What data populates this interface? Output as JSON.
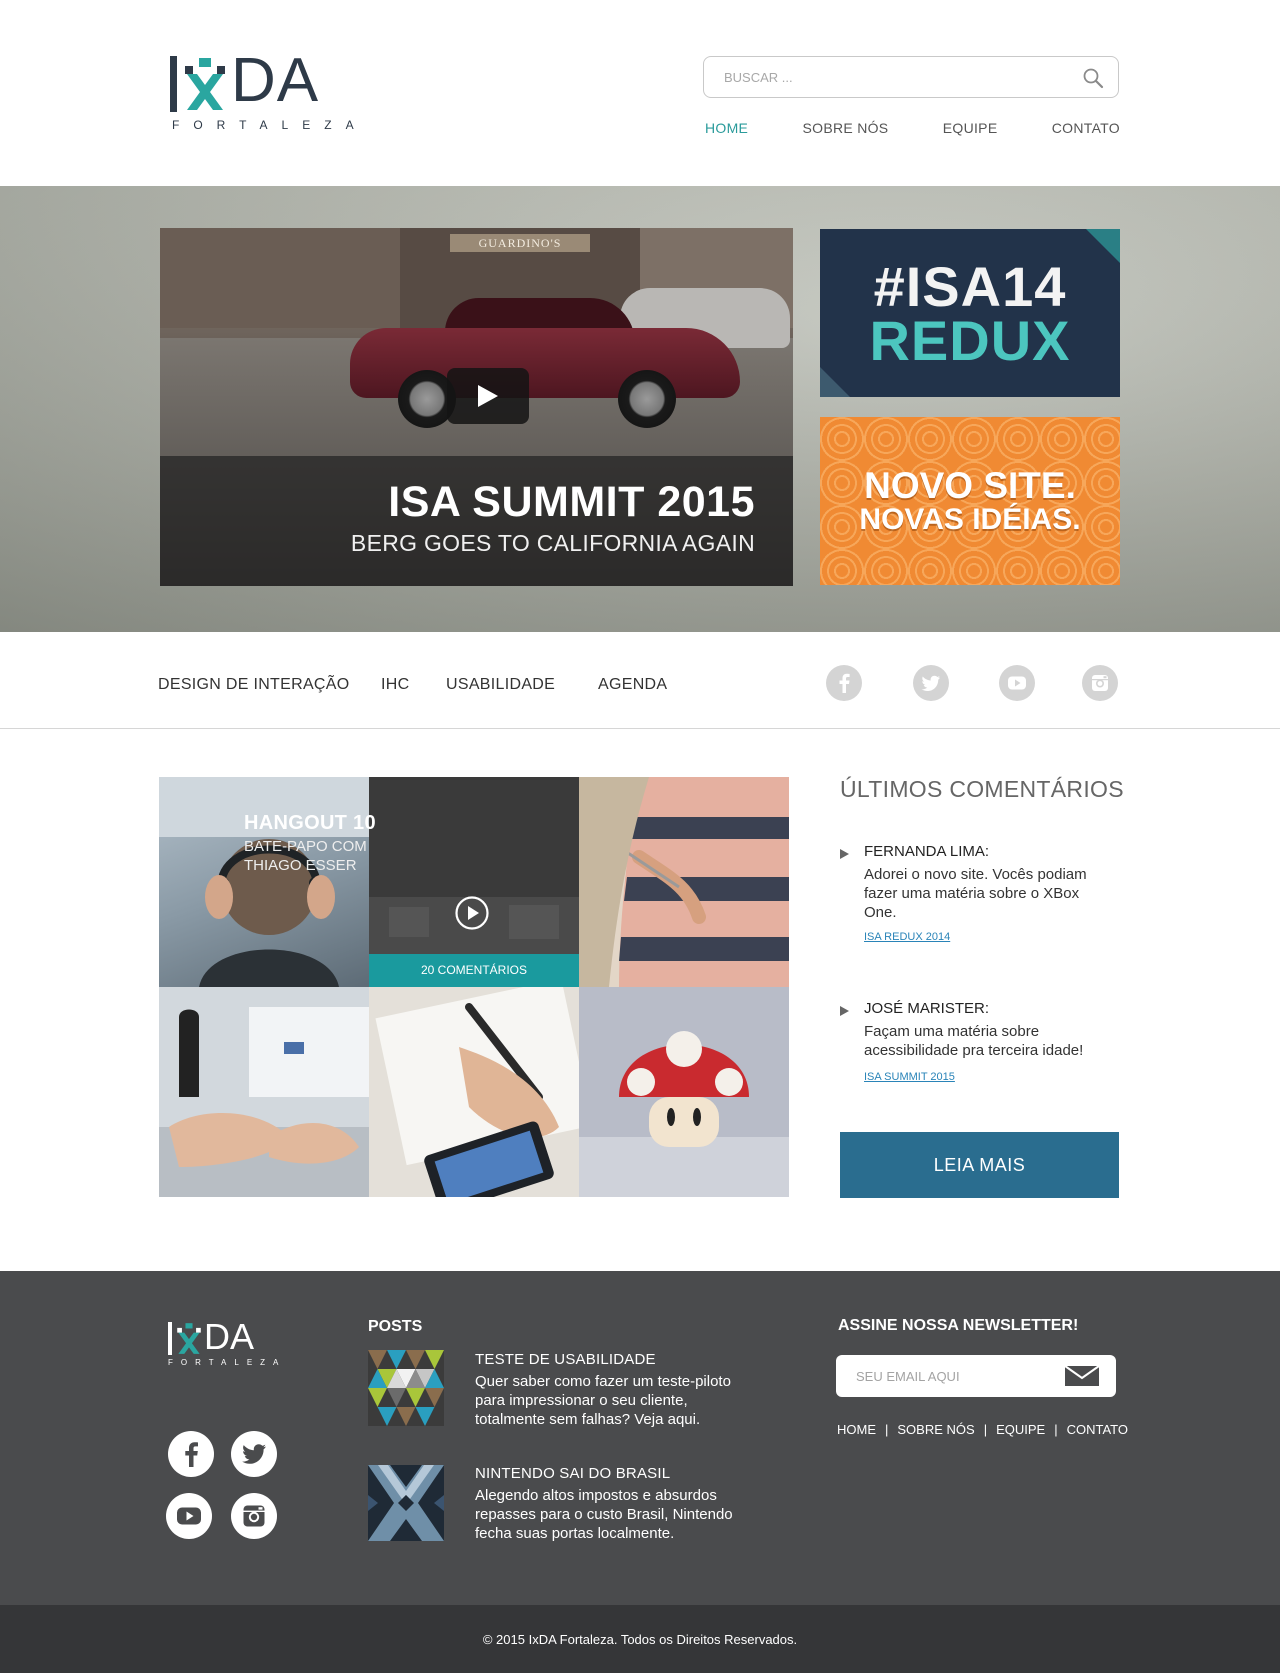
{
  "header": {
    "logo_main": "DA",
    "logo_sub": "FORTALEZA",
    "search_placeholder": "BUSCAR ...",
    "nav": [
      "HOME",
      "SOBRE NÓS",
      "EQUIPE",
      "CONTATO"
    ],
    "active_nav": "HOME"
  },
  "hero": {
    "video_title": "ISA SUMMIT 2015",
    "video_subtitle": "BERG GOES TO CALIFORNIA AGAIN",
    "video_sign": "GUARDINO'S",
    "promo1_line1": "#ISA14",
    "promo1_line2": "REDUX",
    "promo2_line1": "NOVO SITE.",
    "promo2_line2": "NOVAS IDÉIAS."
  },
  "categories": [
    "DESIGN DE INTERAÇÃO",
    "IHC",
    "USABILIDADE",
    "AGENDA"
  ],
  "social_icons": [
    "facebook-icon",
    "twitter-icon",
    "youtube-icon",
    "instagram-icon"
  ],
  "hangout": {
    "title": "HANGOUT 10",
    "subtitle": "BATE-PAPO COM THIAGO ESSER",
    "comments": "20 COMENTÁRIOS"
  },
  "comments": {
    "title": "ÚLTIMOS COMENTÁRIOS",
    "items": [
      {
        "name": "FERNANDA LIMA:",
        "text": "Adorei o novo site. Vocês podiam fazer uma matéria sobre o XBox One.",
        "link": "ISA REDUX 2014"
      },
      {
        "name": "JOSÉ MARISTER:",
        "text": "Façam uma matéria sobre acessibilidade pra terceira idade!",
        "link": "ISA SUMMIT 2015"
      }
    ],
    "read_more": "LEIA MAIS"
  },
  "footer": {
    "logo_main": "DA",
    "logo_sub": "FORTALEZA",
    "posts_title": "POSTS",
    "posts": [
      {
        "title": "TESTE DE USABILIDADE",
        "text": "Quer saber como fazer um teste-piloto para impressionar o seu cliente, totalmente sem falhas? Veja aqui."
      },
      {
        "title": "NINTENDO SAI DO BRASIL",
        "text": "Alegendo altos impostos e absurdos repasses para o custo Brasil, Nintendo fecha suas portas localmente."
      }
    ],
    "newsletter_title": "ASSINE NOSSA NEWSLETTER!",
    "newsletter_placeholder": "SEU EMAIL AQUI",
    "links": [
      "HOME",
      "SOBRE NÓS",
      "EQUIPE",
      "CONTATO"
    ],
    "copyright": "© 2015 IxDA Fortaleza. Todos os Direitos Reservados."
  },
  "colors": {
    "accent_teal": "#2a9b9b",
    "dark_navy": "#2e3a48",
    "button_blue": "#2a6d8f",
    "footer_bg": "#4a4b4d"
  }
}
